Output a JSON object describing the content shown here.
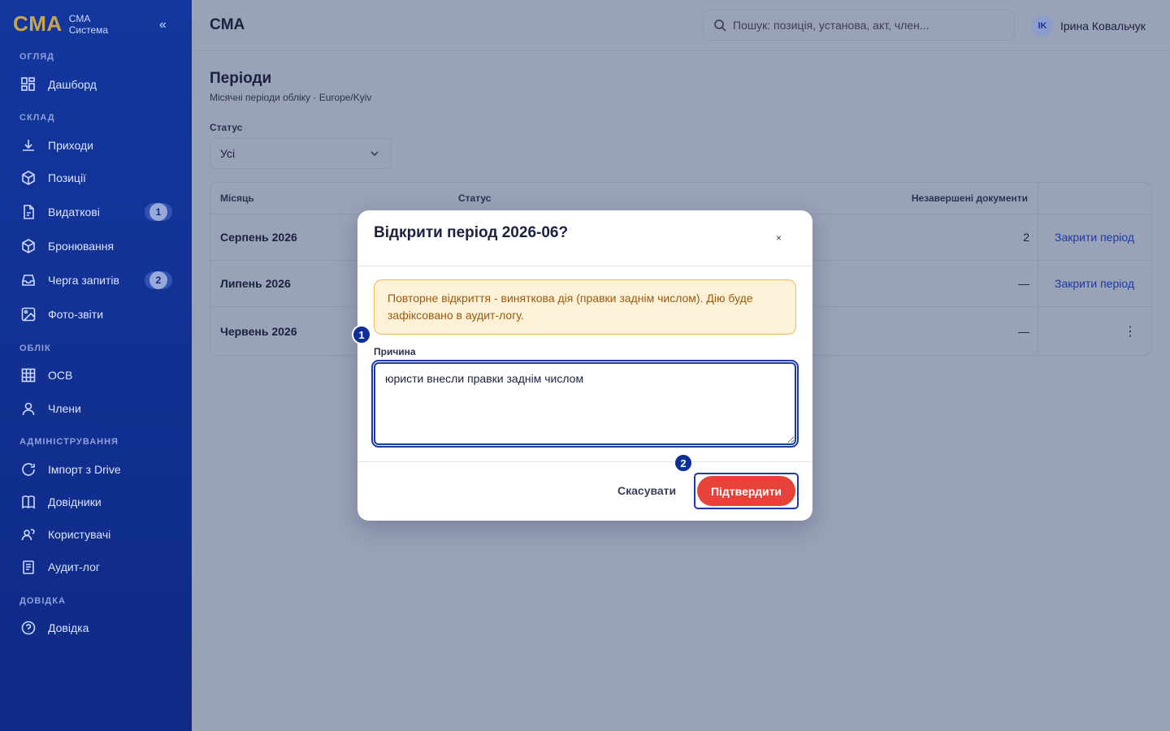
{
  "sidebar": {
    "brand_logo": "CMA",
    "brand_line1": "CMA",
    "brand_line2": "Система",
    "collapse": "«",
    "sections": {
      "overview": "Огляд",
      "warehouse": "Склад",
      "accounting": "Облік",
      "admin": "Адміністрування",
      "help": "Довідка"
    },
    "items": {
      "dashboard": "Дашборд",
      "receipts": "Приходи",
      "positions": "Позиції",
      "expenses": "Видаткові",
      "expenses_badge": "1",
      "bookings": "Бронювання",
      "queue": "Черга запитів",
      "queue_badge": "2",
      "photos": "Фото-звіти",
      "osv": "ОСВ",
      "members": "Члени",
      "import": "Імпорт з Drive",
      "references": "Довідники",
      "users": "Користувачі",
      "audit": "Аудит-лог",
      "help": "Довідка"
    }
  },
  "header": {
    "title": "CMA",
    "search_placeholder": "Пошук: позиція, установа, акт, член...",
    "user_initials": "IK",
    "user_name": "Ірина Ковальчук"
  },
  "main": {
    "title": "Періоди",
    "subtitle": "Місячні періоди обліку · Europe/Kyiv",
    "filter_label": "Статус",
    "filter_value": "Усі",
    "table": {
      "headers": {
        "month": "Місяць",
        "status": "Статус",
        "pending": "Незавершені документи"
      },
      "rows": [
        {
          "month": "Серпень 2026",
          "pending": "2",
          "action": "Закрити період"
        },
        {
          "month": "Липень 2026",
          "pending": "—",
          "action": "Закрити період"
        },
        {
          "month": "Червень 2026",
          "pending": "—",
          "action": "⋮"
        }
      ]
    }
  },
  "modal": {
    "title": "Відкрити період 2026-06?",
    "close": "×",
    "warning": "Повторне відкриття - виняткова дія (правки заднім числом). Дію буде зафіксовано в аудит-логу.",
    "reason_label": "Причина",
    "reason_value": "юристи внесли правки заднім числом",
    "cancel": "Скасувати",
    "confirm": "Підтвердити",
    "step1": "1",
    "step2": "2"
  }
}
